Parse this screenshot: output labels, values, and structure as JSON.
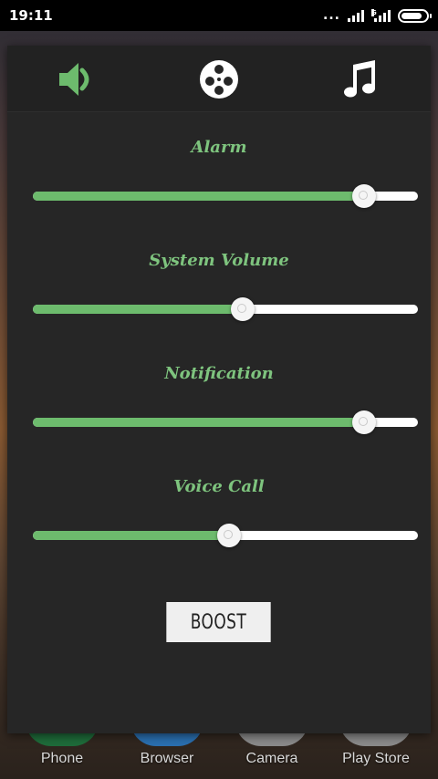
{
  "status_bar": {
    "time": "19:11",
    "dots": "...",
    "network_badge": "G"
  },
  "tabs": [
    {
      "name": "volume",
      "icon": "speaker-icon",
      "active": true
    },
    {
      "name": "media",
      "icon": "film-reel-icon",
      "active": false
    },
    {
      "name": "music",
      "icon": "music-note-icon",
      "active": false
    }
  ],
  "sliders": [
    {
      "label": "Alarm",
      "value": 0.86
    },
    {
      "label": "System Volume",
      "value": 0.545
    },
    {
      "label": "Notification",
      "value": 0.86
    },
    {
      "label": "Voice Call",
      "value": 0.51
    }
  ],
  "boost_label": "BOOST",
  "dock": [
    {
      "label": "Phone",
      "color": "#1e6b3a"
    },
    {
      "label": "Browser",
      "color": "#2a6fb0"
    },
    {
      "label": "Camera",
      "color": "#8a8a8a"
    },
    {
      "label": "Play Store",
      "color": "#8a8a8a"
    }
  ],
  "colors": {
    "accent": "#6dbb6d",
    "label": "#7ec47e",
    "panel": "#262626"
  }
}
